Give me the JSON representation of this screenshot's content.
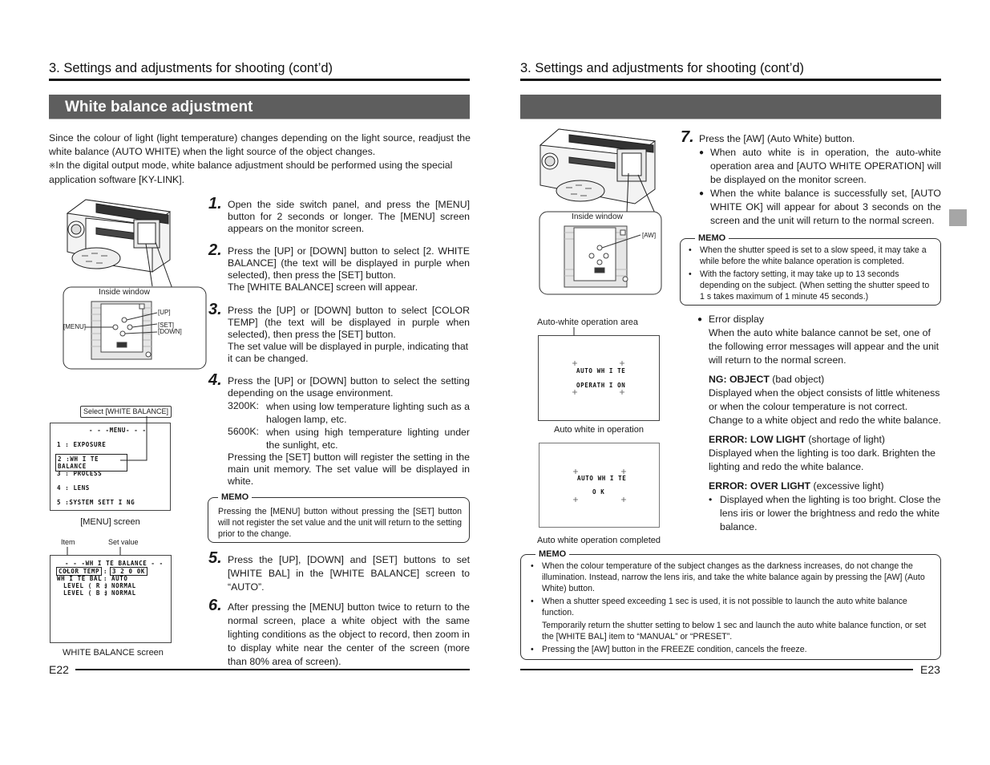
{
  "left_page": {
    "header": "3. Settings and adjustments for shooting (cont’d)",
    "title": "White balance adjustment",
    "intro": "Since the colour of light (light temperature) changes depending on the light source, readjust the white balance (AUTO WHITE) when the light source of the object changes.",
    "note_mark": "※",
    "note": "In the digital output mode, white balance adjustment should be performed using the special application software [KY-LINK].",
    "camera_figure": {
      "inside_window_label": "Inside window",
      "labels": {
        "up": "[UP]",
        "set": "[SET]",
        "down": "[DOWN]",
        "menu": "[MENU]"
      }
    },
    "menu_screen": {
      "callout": "Select [WHITE BALANCE]",
      "title": "- - -MENU- - -",
      "items": [
        "1 : EXPOSURE",
        "2 :WH I TE  BALANCE",
        "3 : PROCESS",
        "4 : LENS",
        "5 :SYSTEM  SETT I NG"
      ],
      "selected_index": 1,
      "caption": "[MENU] screen"
    },
    "wb_screen": {
      "item_label": "Item",
      "set_value_label": "Set value",
      "title": "- - -WH I TE  BALANCE - - -",
      "rows": [
        {
          "item": "COLOR  TEMP",
          "sep": ":",
          "value": "3 2 0 0K"
        },
        {
          "item": "WH I TE  BAL",
          "sep": ":",
          "value": "AUTO"
        },
        {
          "item": "LEVEL ( R )",
          "sep": ":",
          "value": "NORMAL"
        },
        {
          "item": "LEVEL ( B )",
          "sep": ":",
          "value": "NORMAL"
        }
      ],
      "caption": "WHITE BALANCE screen"
    },
    "steps": [
      {
        "num": "1.",
        "text": "Open the side switch panel, and press the [MENU] button for 2 seconds or longer. The [MENU] screen appears on the monitor screen."
      },
      {
        "num": "2.",
        "text": "Press the [UP] or [DOWN] button to select [2. WHITE BALANCE] (the text will be displayed in purple when selected), then press the [SET] button.",
        "extra": "The [WHITE BALANCE] screen will appear."
      },
      {
        "num": "3.",
        "text": "Press the [UP] or [DOWN] button to select [COLOR TEMP] (the text will be displayed in purple when selected), then press the [SET] button.",
        "extra": "The set value will be displayed in purple, indicating that it can be changed."
      },
      {
        "num": "4.",
        "text": "Press the [UP] or [DOWN] button to select the setting depending on the usage environment.",
        "options": [
          {
            "key": "3200K:",
            "desc": "when using low temperature lighting such as a halogen lamp, etc."
          },
          {
            "key": "5600K:",
            "desc": "when using  high temperature lighting under the sunlight, etc."
          }
        ],
        "extra": "Pressing the [SET] button will register the setting in the main unit memory. The set value will be displayed in white."
      },
      {
        "num": "5.",
        "text": "Press the [UP], [DOWN] and [SET] buttons to set [WHITE BAL] in the [WHITE BALANCE] screen to “AUTO”."
      },
      {
        "num": "6.",
        "text": "After pressing the [MENU] button twice to return to the normal screen, place a white object with the same lighting conditions as the object to record, then zoom in to display white near the center of the screen (more than 80% area of screen)."
      }
    ],
    "memo": {
      "label": "MEMO",
      "text": "Pressing the [MENU] button without pressing the [SET] button will not register the set value and the unit will return to the setting prior to the change."
    },
    "page_number": "E22"
  },
  "right_page": {
    "header": "3. Settings and adjustments for shooting (cont’d)",
    "title": "",
    "camera_figure": {
      "inside_window_label": "Inside window",
      "aw_label": "[AW]"
    },
    "auto_white_area_label": "Auto-white operation area",
    "screen_operation": {
      "line1": "AUTO  WH I TE",
      "line2": "OPERATH I ON",
      "caption": "Auto white in operation"
    },
    "screen_ok": {
      "line1": "AUTO  WH I TE",
      "line2": "O   K",
      "caption": "Auto white operation completed"
    },
    "step7": {
      "num": "7.",
      "text": "Press the [AW] (Auto White) button.",
      "bullets": [
        "When auto white is in operation, the auto-white operation area and [AUTO WHITE OPERATION] will be displayed on the monitor screen.",
        "When the white balance is successfully set,  [AUTO WHITE OK] will appear for about 3 seconds on the screen and the unit will return to the normal screen."
      ]
    },
    "memo1": {
      "label": "MEMO",
      "items": [
        "When the shutter speed is set to a slow speed, it may take a while before the white balance operation is completed.",
        "With the factory setting, it may take up to 13 seconds depending on the subject. (When setting the shutter speed to 1 s takes maximum of 1 minute 45 seconds.)"
      ]
    },
    "error_display": {
      "heading": "Error display",
      "intro": "When the auto white balance cannot be set, one of the following error messages will appear and the unit will return to the normal screen.",
      "errors": [
        {
          "code": "NG: OBJECT",
          "meaning": "(bad object)",
          "text": "Displayed when the object consists of little whiteness or when the colour temperature is not correct. Change to a white object and redo the white balance."
        },
        {
          "code": "ERROR: LOW LIGHT",
          "meaning": "(shortage of light)",
          "text": "Displayed when the lighting is too dark. Brighten the lighting and redo the white balance."
        },
        {
          "code": "ERROR: OVER LIGHT",
          "meaning": "(excessive light)",
          "text": "Displayed when the lighting is too bright. Close the lens iris or lower the brightness and redo the white balance."
        }
      ]
    },
    "memo2": {
      "label": "MEMO",
      "items": [
        "When the colour temperature of the subject changes as the darkness increases, do not change the illumination.  Instead, narrow the lens iris, and take the white balance again by pressing the [AW] (Auto White) button.",
        "When a shutter speed exceeding 1 sec is used, it is not possible to launch the auto white balance function.",
        "Pressing the [AW] button in the FREEZE condition, cancels the freeze."
      ],
      "continuation": "Temporarily return the shutter setting to below 1 sec and launch the auto white balance function, or set the [WHITE BAL] item to “MANUAL” or “PRESET”."
    },
    "page_number": "E23",
    "thumb_tab_color": "#a6a6a6"
  },
  "glyphs": {
    "bullet_round": "●",
    "bullet_small": "•"
  }
}
